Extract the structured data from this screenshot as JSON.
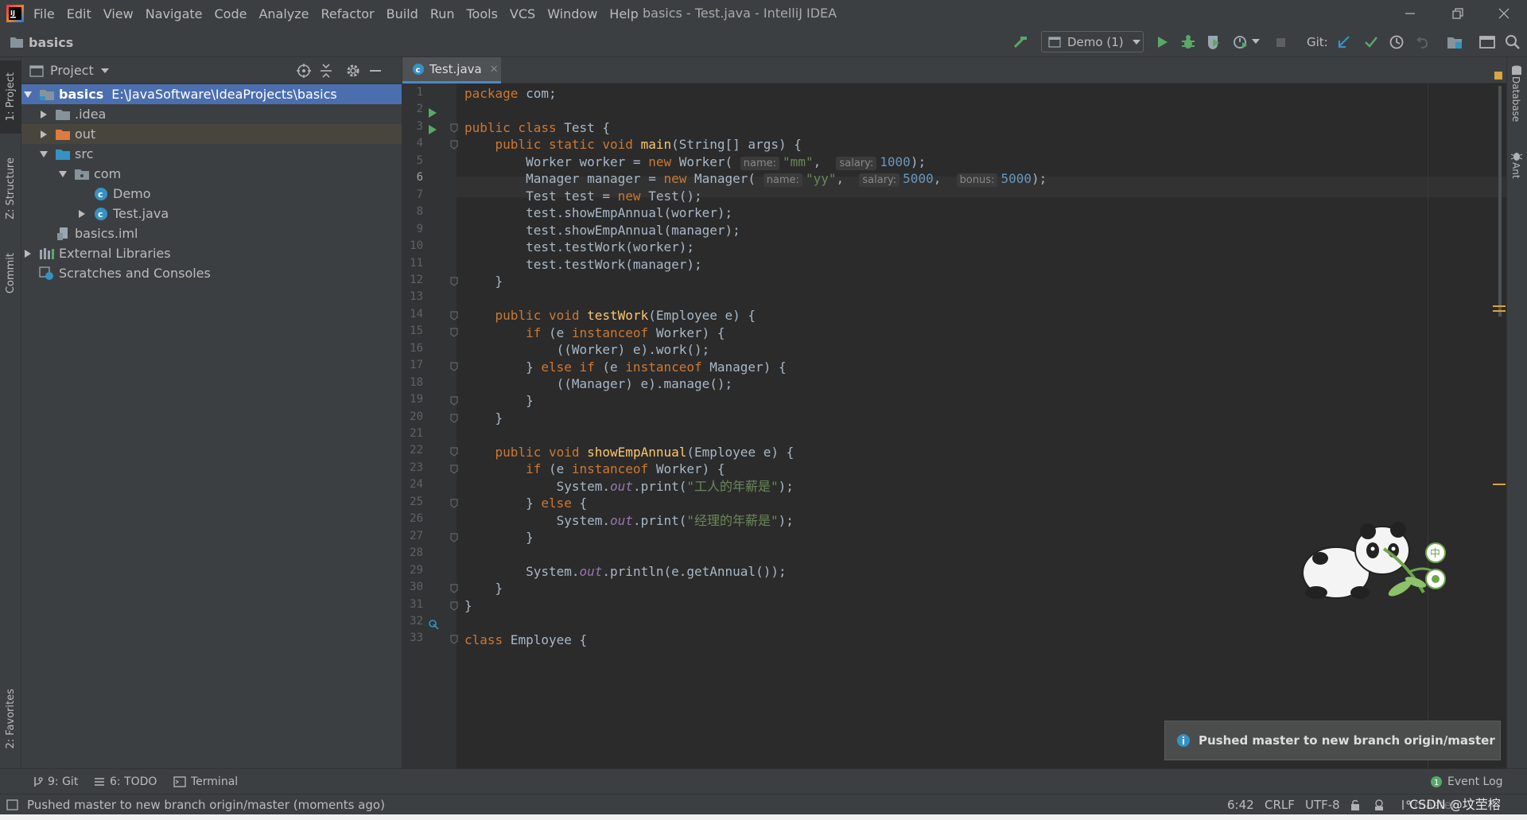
{
  "window": {
    "title": "basics - Test.java - IntelliJ IDEA"
  },
  "menu": [
    "File",
    "Edit",
    "View",
    "Navigate",
    "Code",
    "Analyze",
    "Refactor",
    "Build",
    "Run",
    "Tools",
    "VCS",
    "Window",
    "Help"
  ],
  "navbar": {
    "project_name": "basics",
    "run_config": "Demo (1)",
    "git_label": "Git:"
  },
  "left_stripe": {
    "project_tab": "1: Project",
    "structure_tab": "Z: Structure",
    "commit_tab": "Commit",
    "favorites_tab": "2: Favorites"
  },
  "project_panel": {
    "title": "Project",
    "tree": [
      {
        "label": "basics",
        "path": "E:\\JavaSoftware\\IdeaProjects\\basics",
        "icon": "module-folder-icon",
        "expanded": true,
        "level": 0
      },
      {
        "label": ".idea",
        "icon": "folder-icon",
        "expanded": false,
        "level": 1
      },
      {
        "label": "out",
        "icon": "excluded-folder-icon",
        "expanded": false,
        "level": 1
      },
      {
        "label": "src",
        "icon": "source-folder-icon",
        "expanded": true,
        "level": 1
      },
      {
        "label": "com",
        "icon": "package-icon",
        "expanded": true,
        "level": 2
      },
      {
        "label": "Demo",
        "icon": "java-class-icon",
        "level": 3
      },
      {
        "label": "Test.java",
        "icon": "java-class-icon",
        "expanded": false,
        "level": 3
      },
      {
        "label": "basics.iml",
        "icon": "iml-file-icon",
        "level": 1
      },
      {
        "label": "External Libraries",
        "icon": "libraries-icon",
        "expanded": false,
        "level": 0
      },
      {
        "label": "Scratches and Consoles",
        "icon": "scratches-icon",
        "level": 0
      }
    ]
  },
  "editor": {
    "tab_label": "Test.java",
    "current_line": 6,
    "line_numbers": [
      "1",
      "2",
      "3",
      "4",
      "5",
      "6",
      "7",
      "8",
      "9",
      "10",
      "11",
      "12",
      "13",
      "14",
      "15",
      "16",
      "17",
      "18",
      "19",
      "20",
      "21",
      "22",
      "23",
      "24",
      "25",
      "26",
      "27",
      "28",
      "29",
      "30",
      "31",
      "32",
      "33"
    ],
    "strings": {
      "mm": "\"mm\"",
      "yy": "\"yy\"",
      "worker_annual": "\"工人的年薪是\"",
      "manager_annual": "\"经理的年薪是\""
    },
    "hints": {
      "name": "name:",
      "salary": "salary:",
      "bonus": "bonus:"
    },
    "numbers": {
      "worker_salary": "1000",
      "manager_salary": "5000",
      "manager_bonus": "5000"
    }
  },
  "right_stripe": {
    "database_tab": "Database",
    "ant_tab": "Ant"
  },
  "notification": {
    "message": "Pushed master to new branch origin/master"
  },
  "bottom_tools": {
    "git": "9: Git",
    "todo": "6: TODO",
    "terminal": "Terminal",
    "event_log": "Event Log",
    "event_count": "1"
  },
  "statusbar": {
    "message": "Pushed master to new branch origin/master (moments ago)",
    "position": "6:42",
    "line_sep": "CRLF",
    "encoding": "UTF-8",
    "branch": "master",
    "watermark": "CSDN @坟茔榕"
  },
  "colors": {
    "keyword": "#cc7832",
    "function": "#ffc66d",
    "string": "#6a8759",
    "number": "#6897bb",
    "static_field": "#9876aa",
    "selection": "#4b6eaf"
  }
}
